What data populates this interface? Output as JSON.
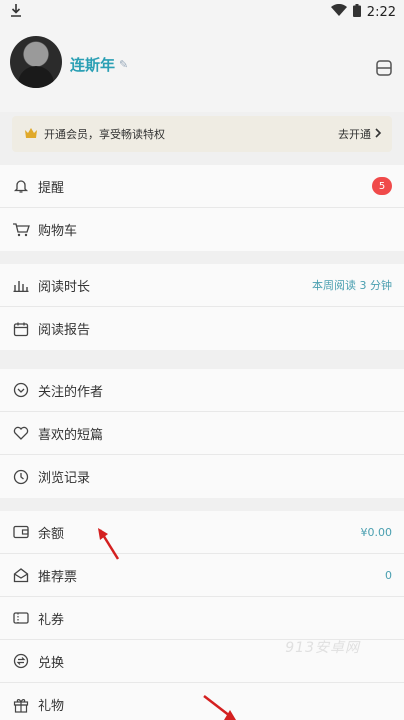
{
  "statusbar": {
    "time": "2:22"
  },
  "profile": {
    "username": "连斯年"
  },
  "vip": {
    "text": "开通会员，享受畅读特权",
    "action": "去开通"
  },
  "sections": [
    {
      "items": [
        {
          "icon": "bell-icon",
          "label": "提醒",
          "badge": "5"
        },
        {
          "icon": "cart-icon",
          "label": "购物车"
        }
      ]
    },
    {
      "items": [
        {
          "icon": "bar-chart-icon",
          "label": "阅读时长",
          "value": "本周阅读 3 分钟"
        },
        {
          "icon": "calendar-icon",
          "label": "阅读报告"
        }
      ]
    },
    {
      "items": [
        {
          "icon": "follow-icon",
          "label": "关注的作者"
        },
        {
          "icon": "heart-icon",
          "label": "喜欢的短篇"
        },
        {
          "icon": "clock-icon",
          "label": "浏览记录"
        }
      ]
    },
    {
      "items": [
        {
          "icon": "wallet-icon",
          "label": "余额",
          "value": "¥0.00"
        },
        {
          "icon": "ticket-icon",
          "label": "推荐票",
          "value": "0"
        },
        {
          "icon": "coupon-icon",
          "label": "礼券"
        },
        {
          "icon": "exchange-icon",
          "label": "兑换"
        },
        {
          "icon": "gift-icon",
          "label": "礼物"
        }
      ]
    }
  ],
  "watermark": "913安卓网",
  "colors": {
    "accent": "#2a9fb4",
    "badge": "#f04a4a",
    "vip_bg": "#efece3"
  }
}
